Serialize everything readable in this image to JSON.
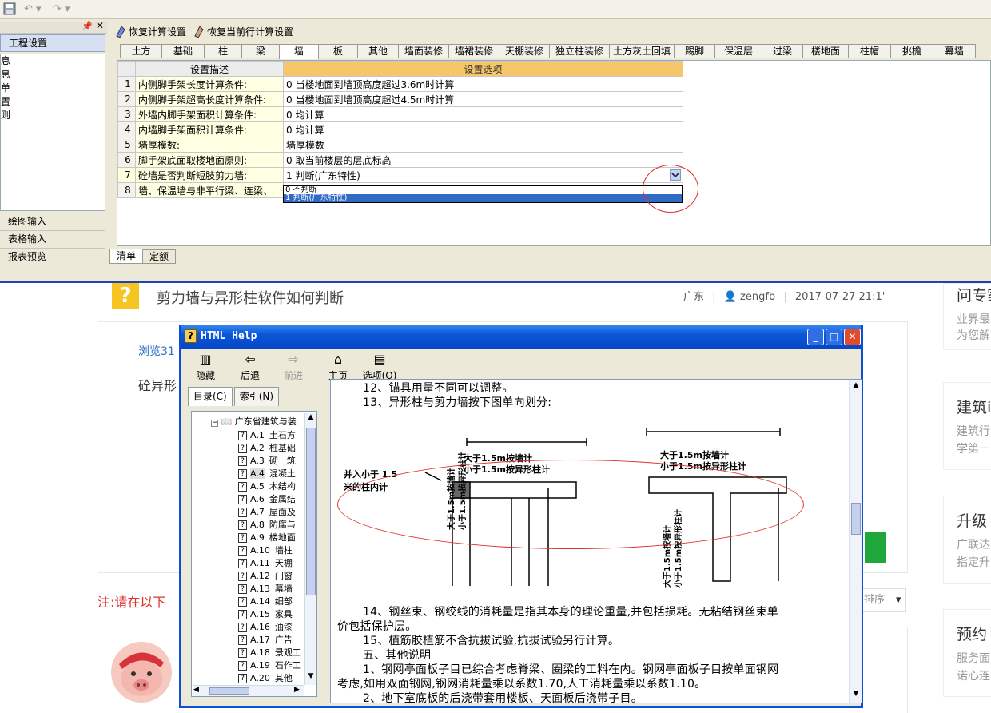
{
  "app": {
    "left_panel": {
      "title": "工程设置",
      "list_items": [
        "息",
        "息",
        "单",
        "置",
        "则"
      ],
      "nav": [
        "绘图输入",
        "表格输入",
        "报表预览"
      ]
    },
    "toolbar_buttons": [
      "恢复计算设置",
      "恢复当前行计算设置"
    ],
    "tabs": [
      "土方",
      "基础",
      "柱",
      "梁",
      "墙",
      "板",
      "其他",
      "墙面装修",
      "墙裙装修",
      "天棚装修",
      "独立柱装修",
      "土方灰土回填",
      "踢脚",
      "保温层",
      "过梁",
      "楼地面",
      "柱帽",
      "挑檐",
      "幕墙"
    ],
    "selected_tab": "墙",
    "grid": {
      "headers": [
        "设置描述",
        "设置选项"
      ],
      "rows": [
        {
          "n": "1",
          "desc": "内侧脚手架长度计算条件:",
          "opt": "0 当楼地面到墙顶高度超过3.6m时计算"
        },
        {
          "n": "2",
          "desc": "内侧脚手架超高长度计算条件:",
          "opt": "0 当楼地面到墙顶高度超过4.5m时计算"
        },
        {
          "n": "3",
          "desc": "外墙内脚手架面积计算条件:",
          "opt": "0 均计算"
        },
        {
          "n": "4",
          "desc": "内墙脚手架面积计算条件:",
          "opt": "0 均计算"
        },
        {
          "n": "5",
          "desc": "墙厚模数:",
          "opt": "墙厚模数"
        },
        {
          "n": "6",
          "desc": "脚手架底面取楼地面原则:",
          "opt": "0 取当前楼层的层底标高"
        },
        {
          "n": "7",
          "desc": "砼墙是否判断短肢剪力墙:",
          "opt": "1 判断(广东特性)"
        },
        {
          "n": "8",
          "desc": "墙、保温墙与非平行梁、连梁、",
          "opt": ""
        }
      ],
      "dropdown_options": [
        "0 不判断",
        "1 判断(广东特性)"
      ],
      "dropdown_selected": "1 判断(广东特性)"
    },
    "bottom_tabs": [
      "清单",
      "定额"
    ],
    "accent_colors": {
      "header_option": "#f7c66b",
      "annotation_circle": "#e0322e",
      "selection": "#316ac5"
    }
  },
  "web": {
    "question_title": "剪力墙与异形柱软件如何判断",
    "meta": {
      "region": "广东",
      "user": "zengfb",
      "datetime": "2017-07-27 21:1'"
    },
    "views_label": "浏览31",
    "body_fragment": "砼异形",
    "notice": "注:请在以下",
    "sort_label": "排序",
    "sidebar": [
      {
        "title": "问专家",
        "lines": [
          "业界最",
          "为您解"
        ]
      },
      {
        "title": "建筑i",
        "lines": [
          "建筑行",
          "学第一"
        ]
      },
      {
        "title": "升级",
        "lines": [
          "广联达",
          "指定升"
        ]
      },
      {
        "title": "预约",
        "lines": [
          "服务面",
          "诺心连"
        ]
      }
    ]
  },
  "help_window": {
    "title": "HTML Help",
    "toolbar": [
      {
        "label": "隐藏",
        "icon": "hide-icon"
      },
      {
        "label": "后退",
        "icon": "back-arrow-icon"
      },
      {
        "label": "前进",
        "icon": "forward-arrow-icon"
      },
      {
        "label": "主页",
        "icon": "home-icon"
      },
      {
        "label": "选项(O)",
        "icon": "options-icon"
      }
    ],
    "tabs": [
      "目录(C)",
      "索引(N)"
    ],
    "tree_root": "广东省建筑与装",
    "tree_items": [
      {
        "code": "A.1",
        "name": "土石方"
      },
      {
        "code": "A.2",
        "name": "桩基础"
      },
      {
        "code": "A.3",
        "name": "砌　筑"
      },
      {
        "code": "A.4",
        "name": "混凝土"
      },
      {
        "code": "A.5",
        "name": "木结构"
      },
      {
        "code": "A.6",
        "name": "金属结"
      },
      {
        "code": "A.7",
        "name": "屋面及"
      },
      {
        "code": "A.8",
        "name": "防腐与"
      },
      {
        "code": "A.9",
        "name": "楼地面"
      },
      {
        "code": "A.10",
        "name": "墙柱"
      },
      {
        "code": "A.11",
        "name": "天棚"
      },
      {
        "code": "A.12",
        "name": "门窗"
      },
      {
        "code": "A.13",
        "name": "幕墙"
      },
      {
        "code": "A.14",
        "name": "细部"
      },
      {
        "code": "A.15",
        "name": "家具"
      },
      {
        "code": "A.16",
        "name": "油漆"
      },
      {
        "code": "A.17",
        "name": "广告"
      },
      {
        "code": "A.18",
        "name": "景观工"
      },
      {
        "code": "A.19",
        "name": "石作工"
      },
      {
        "code": "A.20",
        "name": "其他"
      }
    ],
    "content": {
      "line12": "12、锚具用量不同可以调整。",
      "line13": "13、异形柱与剪力墙按下图单向划分:",
      "fig_left_note1": "并入小于 1.5",
      "fig_left_note2": "米的柱内计",
      "fig_rule1": "大于1.5m按墙计",
      "fig_rule2": "小于1.5m按异形柱计",
      "line14a": "14、钢丝束、钢绞线的消耗量是指其本身的理论重量,并包括损耗。无粘结钢丝束单",
      "line14b": "价包括保护层。",
      "line15": "15、植筋胶植筋不含抗拔试验,抗拔试验另行计算。",
      "section5": "五、其他说明",
      "item1a": "1、钢网亭面板子目已综合考虑脊梁、圈梁的工料在内。钢网亭面板子目按单面钢网",
      "item1b": "考虑,如用双面钢网,钢网消耗量乘以系数1.70,人工消耗量乘以系数1.10。",
      "item2": "2、地下室底板的后浇带套用楼板、天面板后浇带子目。"
    }
  }
}
